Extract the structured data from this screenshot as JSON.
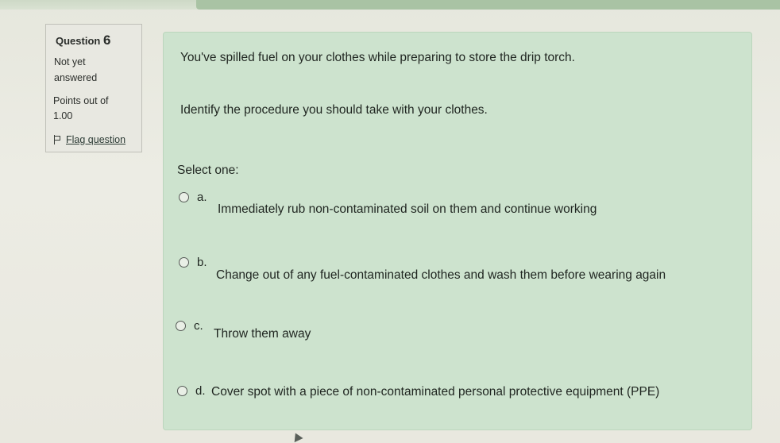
{
  "question": {
    "label": "Question",
    "number": "6",
    "state_line1": "Not yet",
    "state_line2": "answered",
    "grade_line1": "Points out of",
    "grade_line2": "1.00",
    "flag_label": "Flag question",
    "flag_icon": "flag-icon"
  },
  "content": {
    "text1": "You've spilled fuel on your clothes while preparing to store the drip torch.",
    "text2": "Identify the procedure you should take with your clothes.",
    "select_prompt": "Select one:",
    "options": [
      {
        "letter": "a.",
        "text": "Immediately rub non-contaminated soil on them and continue working"
      },
      {
        "letter": "b.",
        "text": "Change out of any fuel-contaminated clothes and wash them before wearing again"
      },
      {
        "letter": "c.",
        "text": "Throw them away"
      },
      {
        "letter": "d.",
        "text": "Cover spot with a piece of non-contaminated personal protective equipment (PPE)"
      }
    ]
  },
  "colors": {
    "content_bg": "#cde3ce",
    "page_bg": "#e9e8df",
    "info_border": "#bfc0b8"
  }
}
